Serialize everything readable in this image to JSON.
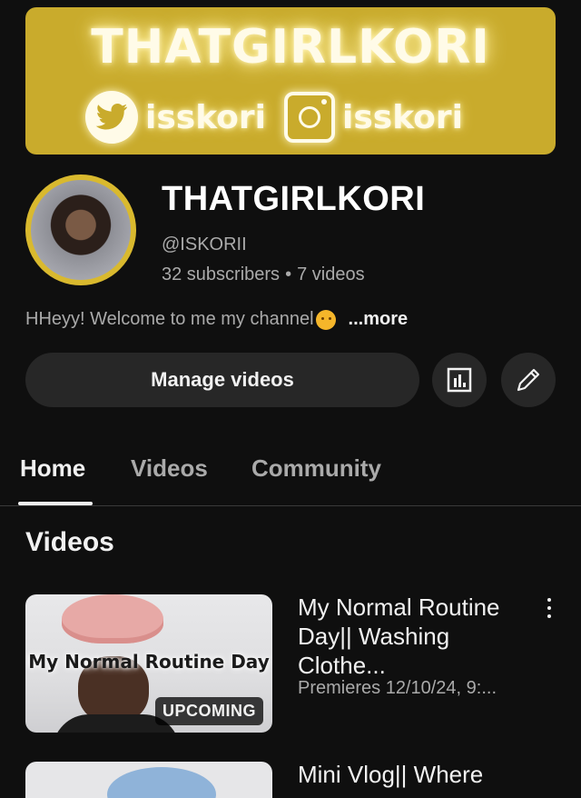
{
  "banner": {
    "title": "THATGIRLKORI",
    "twitter_handle": "isskori",
    "instagram_handle": "isskori",
    "bg_color": "#c9ab2c"
  },
  "channel": {
    "name": "THATGIRLKORI",
    "handle": "@ISKORII",
    "subscribers": "32 subscribers",
    "separator": "•",
    "videos_count": "7 videos",
    "description": "HHeyy! Welcome to me my channel",
    "description_emoji": "face-with-hand-over-mouth-emoji",
    "more_label": "...more",
    "avatar_ring_color": "#d9b92e"
  },
  "actions": {
    "manage_label": "Manage videos",
    "analytics_icon": "analytics-icon",
    "edit_icon": "pencil-icon"
  },
  "tabs": [
    {
      "label": "Home",
      "active": true
    },
    {
      "label": "Videos",
      "active": false
    },
    {
      "label": "Community",
      "active": false
    }
  ],
  "section": {
    "title": "Videos"
  },
  "videos": [
    {
      "thumbnail_text": "My Normal Routine Day",
      "badge": "UPCOMING",
      "title": "My Normal Routine Day|| Washing Clothe...",
      "meta": "Premieres 12/10/24, 9:..."
    },
    {
      "title": "Mini Vlog|| Where"
    }
  ]
}
